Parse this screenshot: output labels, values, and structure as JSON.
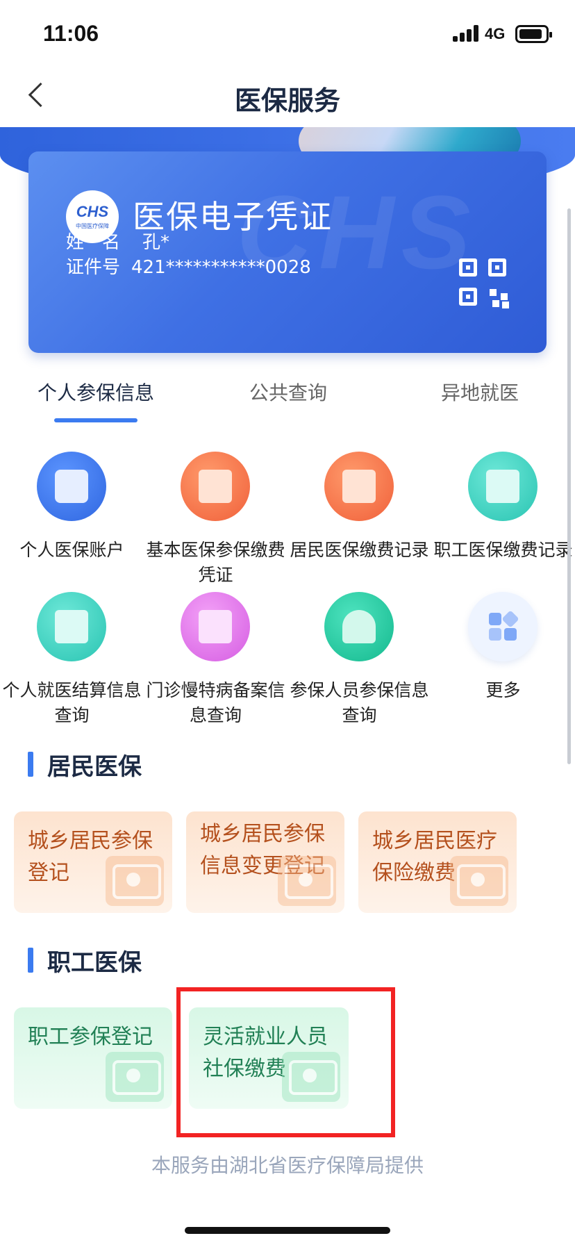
{
  "status": {
    "time": "11:06",
    "network": "4G"
  },
  "nav": {
    "title": "医保服务"
  },
  "card": {
    "logo_text": "CHS",
    "logo_sub": "中国医疗保障",
    "title": "医保电子凭证",
    "name_label": "姓　名",
    "name_value": "孔*",
    "id_label": "证件号",
    "id_value": "421***********0028"
  },
  "tabs": [
    {
      "label": "个人参保信息",
      "active": true
    },
    {
      "label": "公共查询",
      "active": false
    },
    {
      "label": "异地就医",
      "active": false
    }
  ],
  "services": [
    {
      "label": "个人医保账户",
      "icon": "wallet-icon",
      "color": "#3b7bf0"
    },
    {
      "label": "基本医保参保缴费凭证",
      "icon": "voucher-icon",
      "color": "#fb7a49"
    },
    {
      "label": "居民医保缴费记录",
      "icon": "receipt-icon",
      "color": "#fb7a49"
    },
    {
      "label": "职工医保缴费记录",
      "icon": "receipt-icon",
      "color": "#3ed6c5"
    },
    {
      "label": "个人就医结算信息查询",
      "icon": "document-plus-icon",
      "color": "#3ed6c5"
    },
    {
      "label": "门诊慢特病备案信息查询",
      "icon": "medical-clipboard-icon",
      "color": "#e073e9"
    },
    {
      "label": "参保人员参保信息查询",
      "icon": "person-card-icon",
      "color": "#23c9a0"
    },
    {
      "label": "更多",
      "icon": "more-grid-icon",
      "color": "#eef4ff"
    }
  ],
  "resident": {
    "title": "居民医保",
    "tiles": [
      {
        "label": "城乡居民参保登记"
      },
      {
        "label": "城乡居民参保信息变更登记"
      },
      {
        "label": "城乡居民医疗保险缴费"
      }
    ]
  },
  "employee": {
    "title": "职工医保",
    "tiles": [
      {
        "label": "职工参保登记"
      },
      {
        "label": "灵活就业人员社保缴费"
      }
    ]
  },
  "footer": {
    "note": "本服务由湖北省医疗保障局提供"
  },
  "colors": {
    "accent": "#3b7bf0",
    "highlight": "#f22323"
  }
}
